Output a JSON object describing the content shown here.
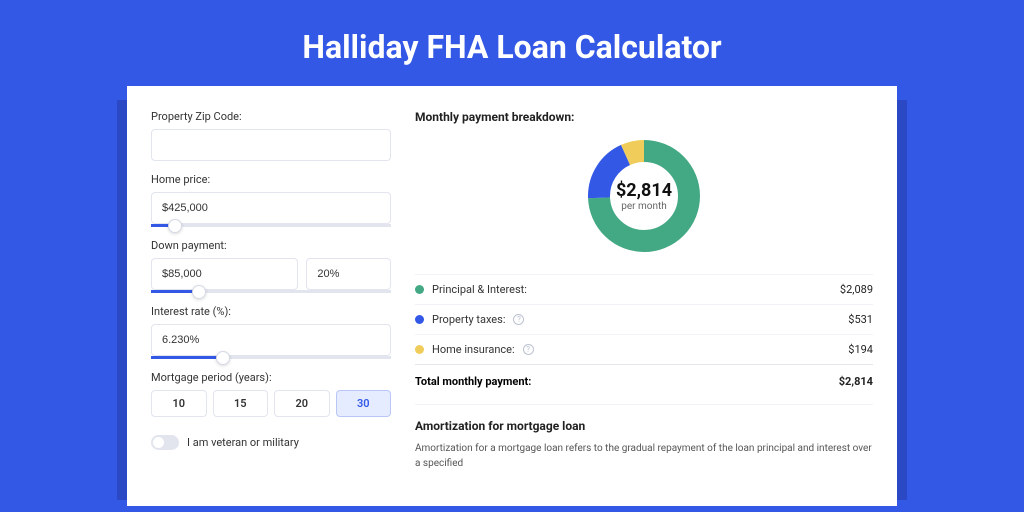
{
  "title": "Halliday FHA Loan Calculator",
  "form": {
    "zip_label": "Property Zip Code:",
    "zip_value": "",
    "price_label": "Home price:",
    "price_value": "$425,000",
    "price_slider_pct": 10,
    "down_label": "Down payment:",
    "down_value": "$85,000",
    "down_pct_value": "20%",
    "down_slider_pct": 20,
    "rate_label": "Interest rate (%):",
    "rate_value": "6.230%",
    "rate_slider_pct": 30,
    "period_label": "Mortgage period (years):",
    "periods": [
      "10",
      "15",
      "20",
      "30"
    ],
    "period_active_index": 3,
    "veteran_label": "I am veteran or military"
  },
  "breakdown": {
    "title": "Monthly payment breakdown:",
    "center_amount": "$2,814",
    "center_sub": "per month",
    "items": [
      {
        "label": "Principal & Interest:",
        "value": "$2,089",
        "color": "#43a884",
        "numeric": 2089,
        "info": false
      },
      {
        "label": "Property taxes:",
        "value": "$531",
        "color": "#3358e6",
        "numeric": 531,
        "info": true
      },
      {
        "label": "Home insurance:",
        "value": "$194",
        "color": "#f0cd5a",
        "numeric": 194,
        "info": true
      }
    ],
    "total_label": "Total monthly payment:",
    "total_value": "$2,814"
  },
  "chart_data": {
    "type": "pie",
    "title": "Monthly payment breakdown",
    "categories": [
      "Principal & Interest",
      "Property taxes",
      "Home insurance"
    ],
    "values": [
      2089,
      531,
      194
    ],
    "colors": [
      "#43a884",
      "#3358e6",
      "#f0cd5a"
    ],
    "center_label": "$2,814 per month"
  },
  "amortization": {
    "title": "Amortization for mortgage loan",
    "text": "Amortization for a mortgage loan refers to the gradual repayment of the loan principal and interest over a specified"
  }
}
